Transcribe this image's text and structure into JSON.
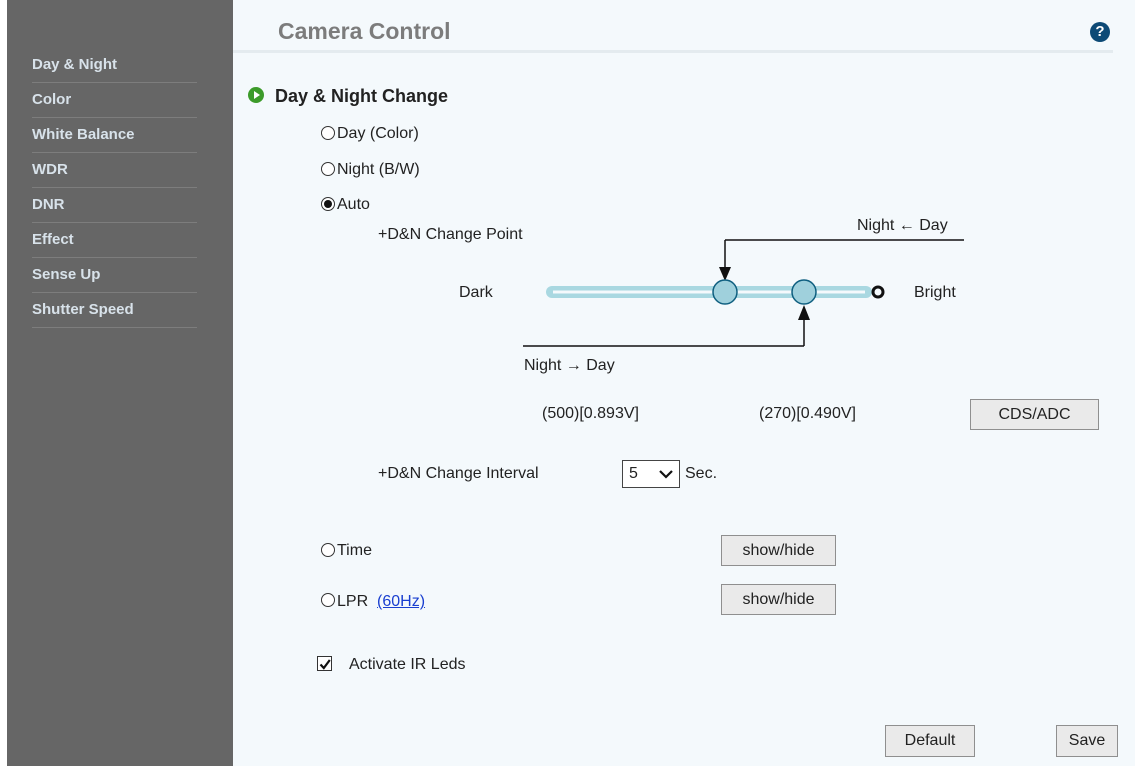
{
  "sidebar": {
    "items": [
      {
        "label": "Day & Night"
      },
      {
        "label": "Color"
      },
      {
        "label": "White Balance"
      },
      {
        "label": "WDR"
      },
      {
        "label": "DNR"
      },
      {
        "label": "Effect"
      },
      {
        "label": "Sense Up"
      },
      {
        "label": "Shutter Speed"
      }
    ]
  },
  "header": {
    "title": "Camera Control",
    "help_icon": "?"
  },
  "section": {
    "title": "Day & Night Change"
  },
  "modes": {
    "day": {
      "label": "Day (Color)",
      "checked": false
    },
    "night": {
      "label": "Night (B/W)",
      "checked": false
    },
    "auto": {
      "label": "Auto",
      "checked": true
    },
    "time": {
      "label": "Time",
      "checked": false
    },
    "lpr": {
      "label": "LPR",
      "link": "(60Hz)",
      "checked": false
    }
  },
  "change_point": {
    "label": "+D&N Change Point",
    "night_from_day": "Night ← Day",
    "night_to_day": "Night → Day",
    "dark_label": "Dark",
    "bright_label": "Bright",
    "night_value": "(500)[0.893V]",
    "day_value": "(270)[0.490V]",
    "cds_button": "CDS/ADC"
  },
  "interval": {
    "label": "+D&N Change Interval",
    "value": "5",
    "unit": "Sec."
  },
  "buttons": {
    "show_hide": "show/hide",
    "default": "Default",
    "save": "Save"
  },
  "ir_leds": {
    "label": "Activate IR Leds",
    "checked": true
  },
  "colors": {
    "sidebar": "#666666",
    "accent": "#3c9b2a",
    "slider": "#a9d8e1"
  }
}
